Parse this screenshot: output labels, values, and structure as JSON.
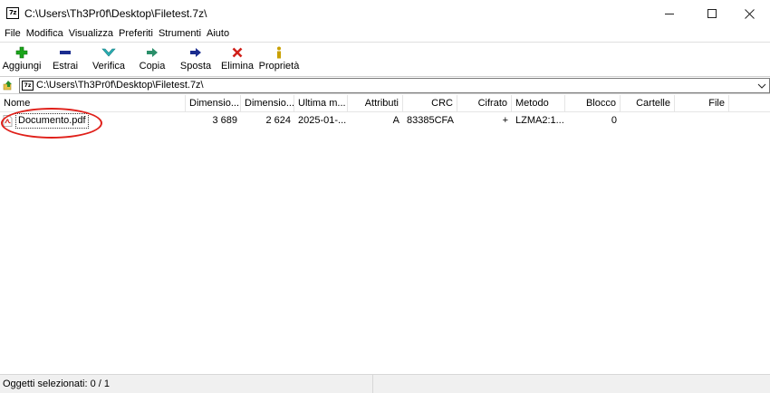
{
  "window": {
    "title": "C:\\Users\\Th3Pr0f\\Desktop\\Filetest.7z\\",
    "app_icon_text": "7z"
  },
  "menu": [
    "File",
    "Modifica",
    "Visualizza",
    "Preferiti",
    "Strumenti",
    "Aiuto"
  ],
  "toolbar": [
    {
      "label": "Aggiungi",
      "icon": "add-icon",
      "color": "#1aa51a"
    },
    {
      "label": "Estrai",
      "icon": "extract-icon",
      "color": "#1a2c8f"
    },
    {
      "label": "Verifica",
      "icon": "test-icon",
      "color": "#2ab3b8"
    },
    {
      "label": "Copia",
      "icon": "copy-icon",
      "color": "#2a8f6a"
    },
    {
      "label": "Sposta",
      "icon": "move-icon",
      "color": "#1a2c8f"
    },
    {
      "label": "Elimina",
      "icon": "delete-icon",
      "color": "#d0201a"
    },
    {
      "label": "Proprietà",
      "icon": "info-icon",
      "color": "#c9a000"
    }
  ],
  "address": {
    "path": "C:\\Users\\Th3Pr0f\\Desktop\\Filetest.7z\\"
  },
  "columns": [
    "Nome",
    "Dimensio...",
    "Dimensio...",
    "Ultima m...",
    "Attributi",
    "CRC",
    "Cifrato",
    "Metodo",
    "Blocco",
    "Cartelle",
    "File"
  ],
  "rows": [
    {
      "name": "Documento.pdf",
      "size": "3 689",
      "packed": "2 624",
      "modified": "2025-01-...",
      "attributes": "A",
      "crc": "83385CFA",
      "encrypted": "+",
      "method": "LZMA2:1...",
      "block": "0",
      "folders": "",
      "files": ""
    }
  ],
  "status": {
    "selected": "Oggetti selezionati: 0 / 1"
  },
  "colors": {
    "highlight": "#e0201a"
  }
}
